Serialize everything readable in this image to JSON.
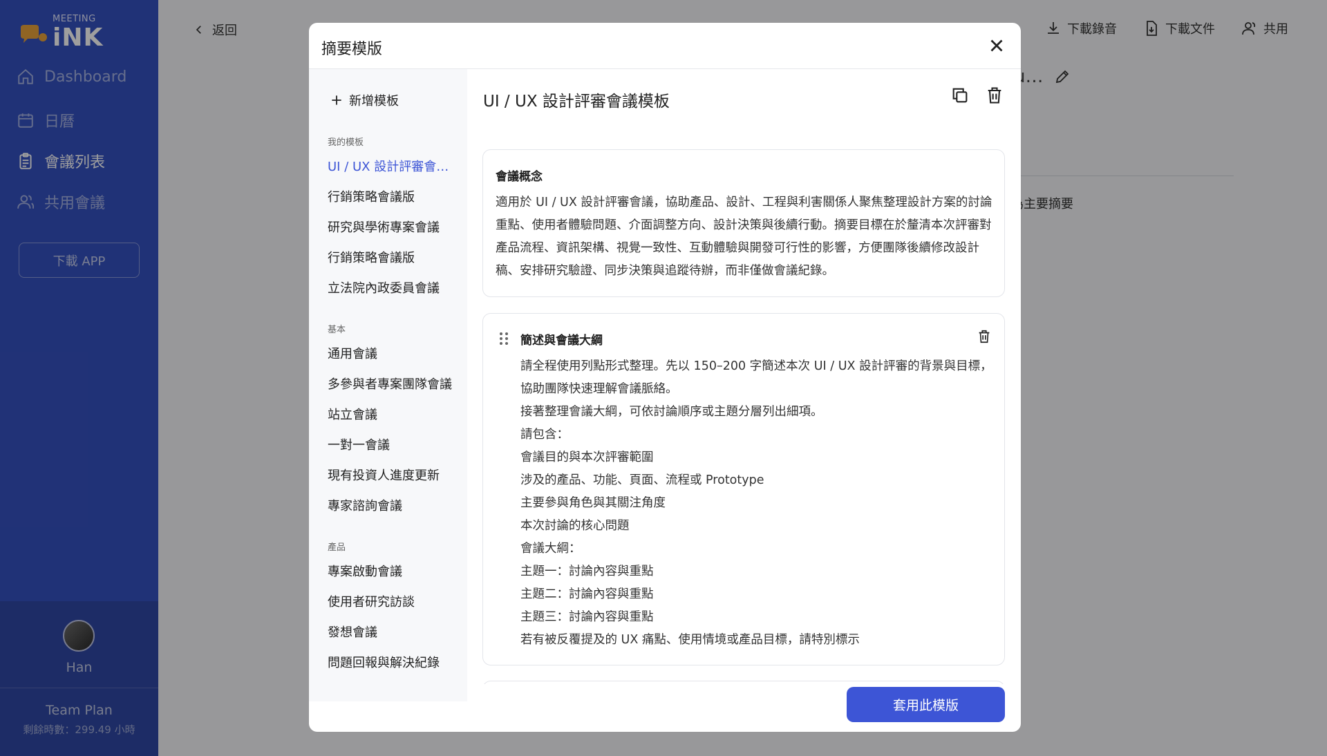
{
  "app": {
    "logo_sub": "MEETING",
    "logo_main": "iNK"
  },
  "sidebar": {
    "items": [
      {
        "label": "Dashboard",
        "icon": "home-icon"
      },
      {
        "label": "日曆",
        "icon": "calendar-icon"
      },
      {
        "label": "會議列表",
        "icon": "clipboard-icon"
      },
      {
        "label": "共用會議",
        "icon": "users-icon"
      }
    ],
    "download_label": "下載 APP",
    "user_name": "Han",
    "plan_name": "Team Plan",
    "plan_remaining": "剩餘時數：299.49 小時"
  },
  "main": {
    "back_label": "返回",
    "actions": [
      {
        "label": "下載錄音",
        "icon": "download-icon"
      },
      {
        "label": "下載文件",
        "icon": "file-download-icon"
      },
      {
        "label": "共用",
        "icon": "share-user-icon"
      }
    ],
    "title_fragment": "u…",
    "summary_fragment": "為主要摘要"
  },
  "modal": {
    "title": "摘要模版",
    "add_label": "新增模板",
    "groups": [
      {
        "label": "我的模板",
        "items": [
          "UI / UX 設計評審會議模板",
          "行銷策略會議版",
          "研究與學術專案會議",
          "行銷策略會議版",
          "立法院內政委員會議"
        ]
      },
      {
        "label": "基本",
        "items": [
          "通用會議",
          "多參與者專案團隊會議",
          "站立會議",
          "一對一會議",
          "現有投資人進度更新",
          "專家諮詢會議"
        ]
      },
      {
        "label": "產品",
        "items": [
          "專案啟動會議",
          "使用者研究訪談",
          "發想會議",
          "問題回報與解決紀錄"
        ]
      }
    ],
    "detail": {
      "title": "UI / UX 設計評審會議模板",
      "concept_heading": "會議概念",
      "concept_body": "適用於 UI / UX 設計評審會議，協助產品、設計、工程與利害關係人聚焦整理設計方案的討論重點、使用者體驗問題、介面調整方向、設計決策與後續行動。摘要目標在於釐清本次評審對產品流程、資訊架構、視覺一致性、互動體驗與開發可行性的影響，方便團隊後續修改設計稿、安排研究驗證、同步決策與追蹤待辦，而非僅做會議紀錄。",
      "section_heading": "簡述與會議大綱",
      "section_lines": [
        "請全程使用列點形式整理。先以 150–200 字簡述本次 UI / UX 設計評審的背景與目標，協助團隊快速理解會議脈絡。",
        "接著整理會議大綱，可依討論順序或主題分層列出細項。",
        "請包含：",
        "會議目的與本次評審範圍",
        "涉及的產品、功能、頁面、流程或 Prototype",
        "主要參與角色與其關注角度",
        "本次討論的核心問題",
        "會議大綱：",
        "主題一：討論內容與重點",
        "主題二：討論內容與重點",
        "主題三：討論內容與重點",
        "若有被反覆提及的 UX 痛點、使用情境或產品目標，請特別標示"
      ]
    },
    "apply_label": "套用此模版"
  },
  "colors": {
    "sidebar": "#3551c0",
    "sidebar_bottom": "#2f47a5",
    "accent": "#3d55d6"
  }
}
